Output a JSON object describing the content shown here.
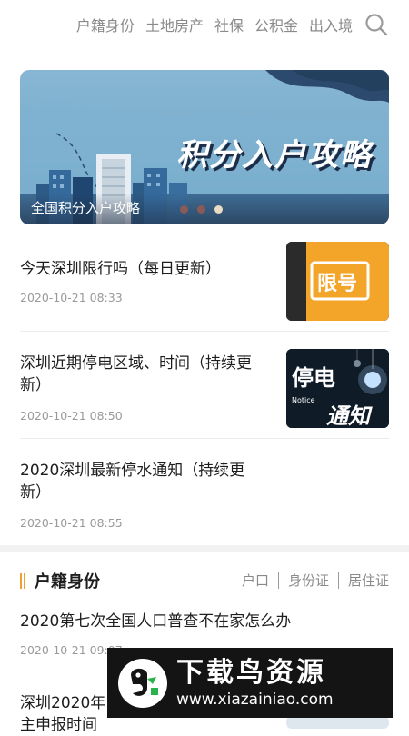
{
  "nav": {
    "items": [
      "户籍身份",
      "土地房产",
      "社保",
      "公积金",
      "出入境"
    ],
    "search_icon": "search-icon"
  },
  "banner": {
    "headline": "积分入户攻略",
    "caption": "全国积分入户攻略",
    "dot_colors": [
      "#8a5a56",
      "#8a5a56",
      "#e8dcc2"
    ]
  },
  "news": [
    {
      "title": "今天深圳限行吗（每日更新）",
      "time": "2020-10-21 08:33",
      "thumb_text": "限号"
    },
    {
      "title": "深圳近期停电区域、时间（持续更新）",
      "time": "2020-10-21 08:50",
      "thumb_text": "停电",
      "thumb_text2": "通知",
      "thumb_small": "Notice"
    },
    {
      "title": "2020深圳最新停水通知（持续更新）",
      "time": "2020-10-21 08:55"
    }
  ],
  "section": {
    "title": "户籍身份",
    "tabs": [
      "户口",
      "身份证",
      "居住证"
    ],
    "items": [
      {
        "title": "2020第七次全国人口普查不在家怎么办",
        "time": "2020-10-21 09:07"
      },
      {
        "title": "深圳2020年",
        "title_line2": "主申报时间"
      }
    ]
  },
  "watermark": {
    "text": "下载鸟资源",
    "url": "www.xiazainiao.com"
  },
  "colors": {
    "accent": "#f0a030",
    "banner_bg": "#7aaecd",
    "headline_shadow": "#1d2d47"
  }
}
